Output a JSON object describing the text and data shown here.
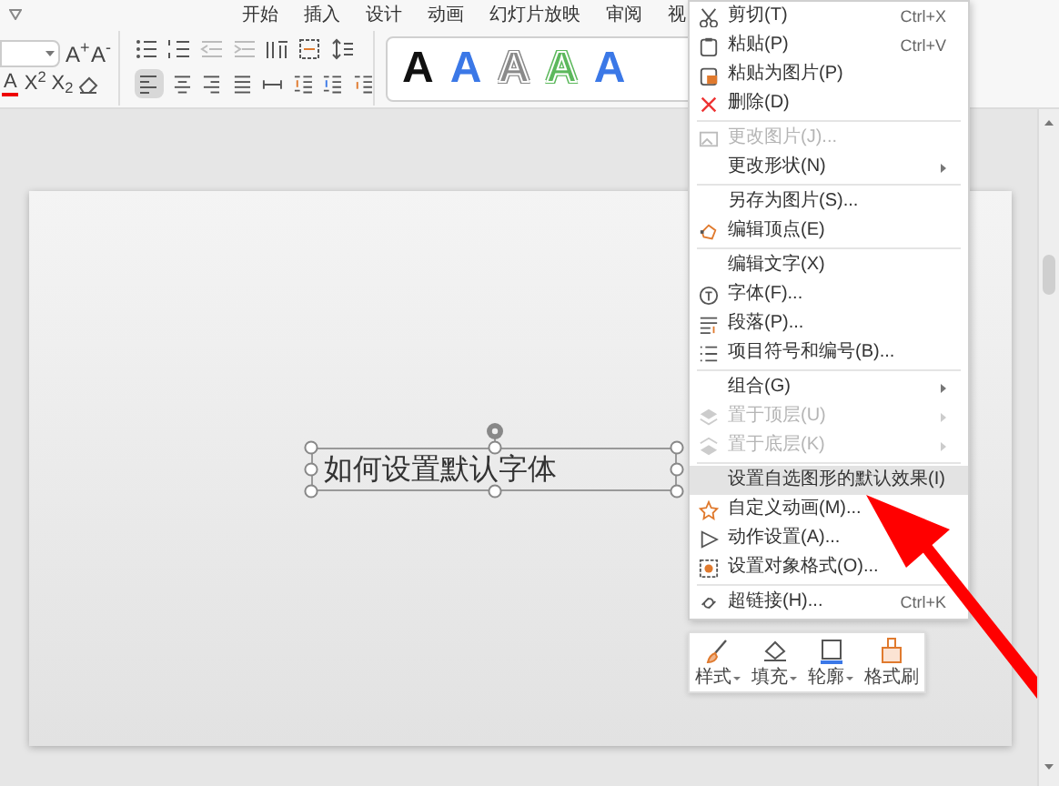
{
  "ribbon": {
    "tabs": [
      {
        "label": "开始",
        "selected": false
      },
      {
        "label": "插入",
        "selected": false
      },
      {
        "label": "设计",
        "selected": false
      },
      {
        "label": "动画",
        "selected": false
      },
      {
        "label": "幻灯片放映",
        "selected": false
      },
      {
        "label": "审阅",
        "selected": false
      },
      {
        "label": "视",
        "selected": false
      }
    ],
    "font_buttons": [
      "A$^{+}$",
      "A$^{-}$"
    ],
    "format_buttons": [
      "A",
      "X$^{2}$",
      "X$_{2}$"
    ],
    "wordart_styles": [
      {
        "label": "A",
        "kind": "solid",
        "color": "#111111"
      },
      {
        "label": "A",
        "kind": "solid",
        "color": "#3b78e7"
      },
      {
        "label": "A",
        "kind": "outline",
        "color": "#8a8a8a"
      },
      {
        "label": "A",
        "kind": "outline",
        "color": "#5cb85c"
      },
      {
        "label": "A",
        "kind": "solid",
        "color": "#3b78e7"
      }
    ]
  },
  "slide": {
    "textbox": "如何设置默认字体"
  },
  "context_menu": {
    "items": [
      {
        "kind": "item",
        "label": "剪切(T)",
        "shortcut": "Ctrl+X",
        "disabled": false,
        "submenu": false,
        "selected": false
      },
      {
        "kind": "item",
        "label": "粘贴(P)",
        "shortcut": "Ctrl+V",
        "disabled": false,
        "submenu": false,
        "selected": false
      },
      {
        "kind": "item",
        "label": "粘贴为图片(P)",
        "disabled": false,
        "submenu": false,
        "selected": false
      },
      {
        "kind": "item",
        "label": "删除(D)",
        "disabled": false,
        "submenu": false,
        "selected": false
      },
      {
        "kind": "separator"
      },
      {
        "kind": "item",
        "label": "更改图片(J)...",
        "disabled": true,
        "submenu": false,
        "selected": false
      },
      {
        "kind": "item",
        "label": "更改形状(N)",
        "disabled": false,
        "submenu": true,
        "selected": false
      },
      {
        "kind": "separator"
      },
      {
        "kind": "item",
        "label": "另存为图片(S)...",
        "disabled": false,
        "submenu": false,
        "selected": false
      },
      {
        "kind": "item",
        "label": "编辑顶点(E)",
        "disabled": false,
        "submenu": false,
        "selected": false
      },
      {
        "kind": "separator"
      },
      {
        "kind": "item",
        "label": "编辑文字(X)",
        "disabled": false,
        "submenu": false,
        "selected": false
      },
      {
        "kind": "item",
        "label": "字体(F)...",
        "disabled": false,
        "submenu": false,
        "selected": false
      },
      {
        "kind": "item",
        "label": "段落(P)...",
        "disabled": false,
        "submenu": false,
        "selected": false
      },
      {
        "kind": "item",
        "label": "项目符号和编号(B)...",
        "disabled": false,
        "submenu": false,
        "selected": false
      },
      {
        "kind": "separator"
      },
      {
        "kind": "item",
        "label": "组合(G)",
        "disabled": false,
        "submenu": true,
        "selected": false
      },
      {
        "kind": "item",
        "label": "置于顶层(U)",
        "disabled": true,
        "submenu": true,
        "selected": false
      },
      {
        "kind": "item",
        "label": "置于底层(K)",
        "disabled": true,
        "submenu": true,
        "selected": false
      },
      {
        "kind": "separator"
      },
      {
        "kind": "item",
        "label": "设置自选图形的默认效果(I)",
        "disabled": false,
        "submenu": false,
        "selected": true
      },
      {
        "kind": "item",
        "label": "自定义动画(M)...",
        "disabled": false,
        "submenu": false,
        "selected": false
      },
      {
        "kind": "item",
        "label": "动作设置(A)...",
        "disabled": false,
        "submenu": false,
        "selected": false
      },
      {
        "kind": "item",
        "label": "设置对象格式(O)...",
        "disabled": false,
        "submenu": false,
        "selected": false
      },
      {
        "kind": "separator"
      },
      {
        "kind": "item",
        "label": "超链接(H)...",
        "shortcut": "Ctrl+K",
        "disabled": false,
        "submenu": false,
        "selected": false
      }
    ]
  },
  "mini_toolbar": [
    {
      "label": "样式",
      "dropdown": true
    },
    {
      "label": "填充",
      "dropdown": true
    },
    {
      "label": "轮廓",
      "dropdown": true
    },
    {
      "label": "格式刷",
      "dropdown": false
    }
  ]
}
